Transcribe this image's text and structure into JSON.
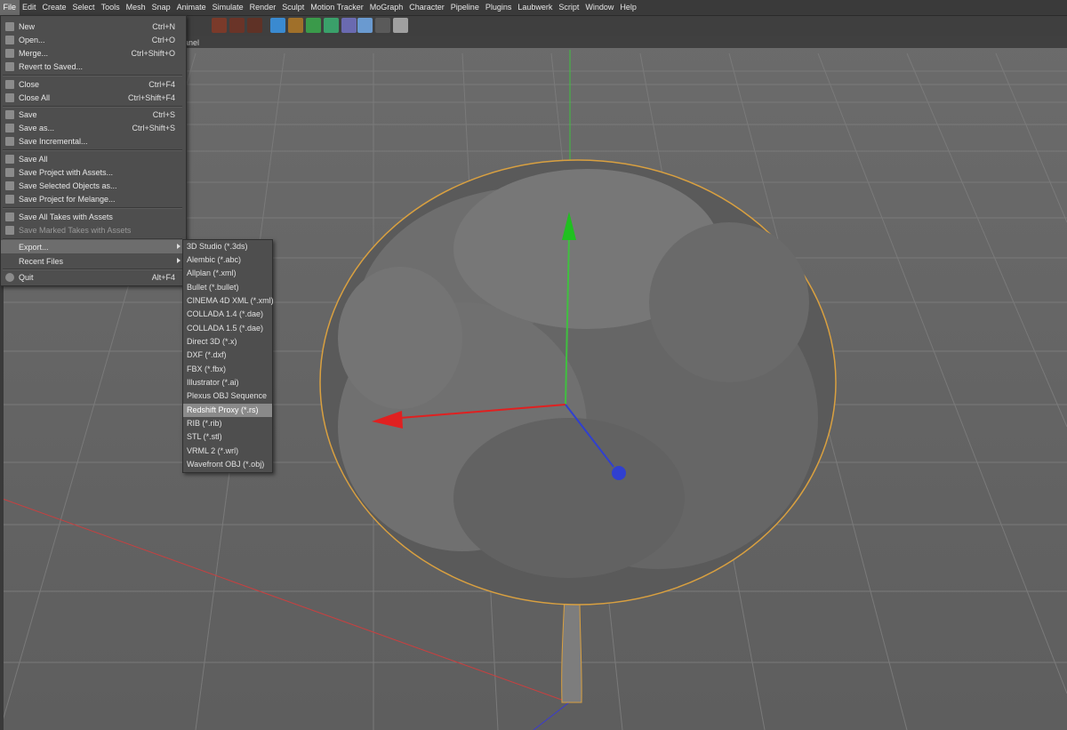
{
  "menubar": {
    "items": [
      "File",
      "Edit",
      "Create",
      "Select",
      "Tools",
      "Mesh",
      "Snap",
      "Animate",
      "Simulate",
      "Render",
      "Sculpt",
      "Motion Tracker",
      "MoGraph",
      "Character",
      "Pipeline",
      "Plugins",
      "Laubwerk",
      "Script",
      "Window",
      "Help"
    ]
  },
  "viewport": {
    "label_fragment": "anel"
  },
  "file_menu": {
    "items": [
      {
        "label": "New",
        "shortcut": "Ctrl+N",
        "icon": "new-file-icon"
      },
      {
        "label": "Open...",
        "shortcut": "Ctrl+O",
        "icon": "open-folder-icon"
      },
      {
        "label": "Merge...",
        "shortcut": "Ctrl+Shift+O",
        "icon": "merge-icon"
      },
      {
        "label": "Revert to Saved...",
        "shortcut": "",
        "icon": "revert-icon"
      },
      {
        "label": "Close",
        "shortcut": "Ctrl+F4",
        "icon": "close-file-icon"
      },
      {
        "label": "Close All",
        "shortcut": "Ctrl+Shift+F4",
        "icon": "close-all-icon"
      },
      {
        "label": "Save",
        "shortcut": "Ctrl+S",
        "icon": "save-icon"
      },
      {
        "label": "Save as...",
        "shortcut": "Ctrl+Shift+S",
        "icon": "save-as-icon"
      },
      {
        "label": "Save Incremental...",
        "shortcut": "",
        "icon": "save-incremental-icon"
      },
      {
        "label": "Save All",
        "shortcut": "",
        "icon": "save-all-icon"
      },
      {
        "label": "Save Project with Assets...",
        "shortcut": "",
        "icon": "save-project-icon"
      },
      {
        "label": "Save Selected Objects as...",
        "shortcut": "",
        "icon": "save-selected-icon"
      },
      {
        "label": "Save Project for Melange...",
        "shortcut": "",
        "icon": "save-melange-icon"
      },
      {
        "label": "Save All Takes with Assets",
        "shortcut": "",
        "icon": "save-takes-icon"
      },
      {
        "label": "Save Marked Takes with Assets",
        "shortcut": "",
        "icon": "save-marked-takes-icon"
      },
      {
        "label": "Export...",
        "shortcut": "",
        "icon": ""
      },
      {
        "label": "Recent Files",
        "shortcut": "",
        "icon": ""
      },
      {
        "label": "Quit",
        "shortcut": "Alt+F4",
        "icon": "power-icon"
      }
    ]
  },
  "export_menu": {
    "items": [
      "3D Studio (*.3ds)",
      "Alembic (*.abc)",
      "Allplan (*.xml)",
      "Bullet (*.bullet)",
      "CINEMA 4D XML (*.xml)",
      "COLLADA 1.4 (*.dae)",
      "COLLADA 1.5 (*.dae)",
      "Direct 3D (*.x)",
      "DXF (*.dxf)",
      "FBX (*.fbx)",
      "Illustrator (*.ai)",
      "Plexus OBJ Sequence",
      "Redshift Proxy (*.rs)",
      "RIB (*.rib)",
      "STL (*.stl)",
      "VRML 2 (*.wrl)",
      "Wavefront OBJ (*.obj)"
    ],
    "selected": "Redshift Proxy (*.rs)"
  },
  "colors": {
    "axis_x": "#e02020",
    "axis_y": "#20c020",
    "axis_z": "#3040d0",
    "selection_outline": "#d9a040"
  }
}
